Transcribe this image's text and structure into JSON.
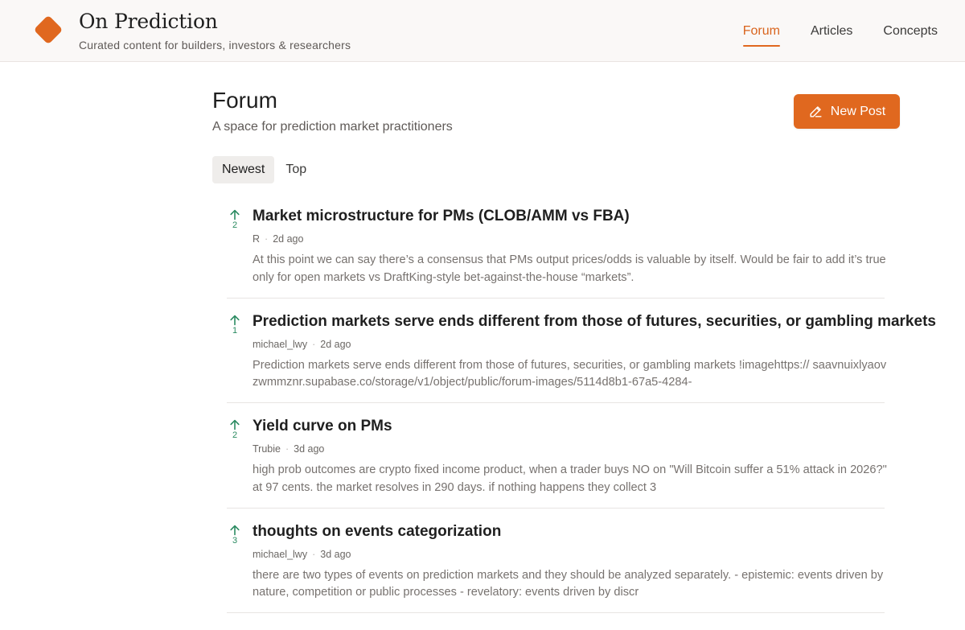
{
  "header": {
    "brand_title": "On Prediction",
    "brand_tagline": "Curated content for builders, investors & researchers",
    "nav": [
      {
        "label": "Forum",
        "active": true
      },
      {
        "label": "Articles",
        "active": false
      },
      {
        "label": "Concepts",
        "active": false
      }
    ]
  },
  "main": {
    "title": "Forum",
    "subtitle": "A space for prediction market practitioners",
    "new_post_label": "New Post",
    "tabs": [
      {
        "label": "Newest",
        "active": true
      },
      {
        "label": "Top",
        "active": false
      }
    ],
    "posts": [
      {
        "votes": "2",
        "title": "Market microstructure for PMs (CLOB/AMM vs FBA)",
        "author": "R",
        "time": "2d ago",
        "excerpt": "At this point we can say there’s a consensus that PMs output prices/odds is valuable by itself. Would be fair to add it’s true only for open markets vs DraftKing-style bet-against-the-house “markets”."
      },
      {
        "votes": "1",
        "title": "Prediction markets serve ends different from those of futures, securities, or gambling markets",
        "author": "michael_lwy",
        "time": "2d ago",
        "excerpt": "Prediction markets serve ends different from those of futures, securities, or gambling markets !imagehttps:// saavnuixlyaovzwmmznr.supabase.co/storage/v1/object/public/forum-images/5114d8b1-67a5-4284-"
      },
      {
        "votes": "2",
        "title": "Yield curve on PMs",
        "author": "Trubie",
        "time": "3d ago",
        "excerpt": "high prob outcomes are crypto fixed income product, when a trader buys NO on \"Will Bitcoin suffer a 51% attack in 2026?\" at 97 cents. the market resolves in 290 days. if nothing happens they collect 3"
      },
      {
        "votes": "3",
        "title": "thoughts on events categorization",
        "author": "michael_lwy",
        "time": "3d ago",
        "excerpt": "there are two types of events on prediction markets and they should be analyzed separately. - epistemic: events driven by nature, competition or public processes - revelatory: events driven by discr"
      }
    ]
  },
  "colors": {
    "accent": "#e0681f",
    "upvote": "#2a8a60",
    "muted_text": "#77726f"
  },
  "icons": {
    "logo": "diamond-logo-icon",
    "new_post": "pencil-icon",
    "vote": "arrow-up-icon"
  }
}
